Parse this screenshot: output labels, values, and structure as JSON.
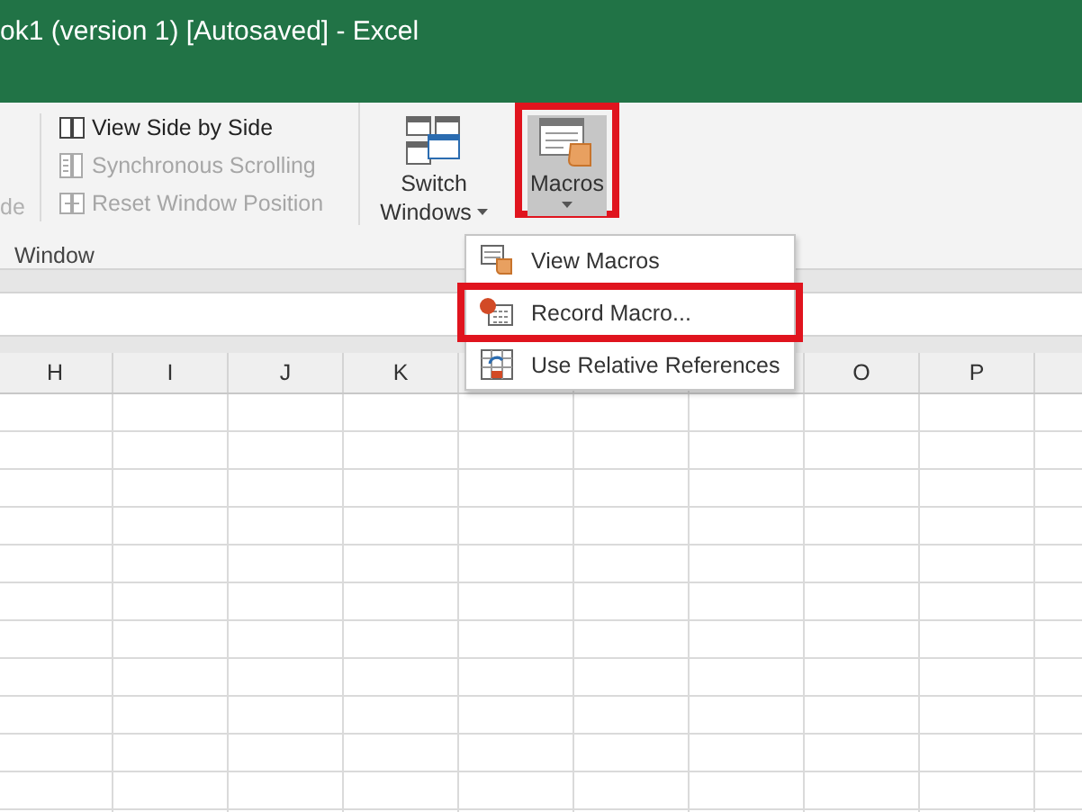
{
  "window": {
    "title": "ok1 (version 1) [Autosaved] - Excel"
  },
  "ribbon": {
    "cut_label": "de",
    "small_buttons": [
      {
        "label": "View Side by Side",
        "disabled": false
      },
      {
        "label": "Synchronous Scrolling",
        "disabled": true
      },
      {
        "label": "Reset Window Position",
        "disabled": true
      }
    ],
    "large_buttons": [
      {
        "label": "Switch Windows",
        "kind": "switch",
        "highlighted": false,
        "pressed": false
      },
      {
        "label": "Macros",
        "kind": "macros",
        "highlighted": true,
        "pressed": true
      }
    ],
    "group_label": "Window"
  },
  "menu": {
    "items": [
      {
        "label": "View Macros",
        "kind": "view",
        "highlighted": false
      },
      {
        "label": "Record Macro...",
        "kind": "record",
        "highlighted": true
      },
      {
        "label": "Use Relative References",
        "kind": "relative",
        "highlighted": false
      }
    ]
  },
  "sheet": {
    "columns": [
      "H",
      "I",
      "J",
      "K",
      null,
      null,
      null,
      "O",
      "P"
    ]
  }
}
